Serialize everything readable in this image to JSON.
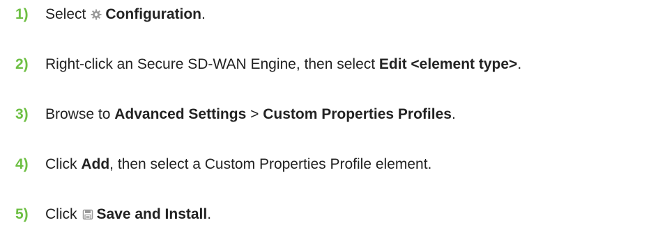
{
  "steps": [
    {
      "number": "1)",
      "parts": {
        "t1": "Select",
        "icon": "gear-icon",
        "b1": "Configuration",
        "t2": "."
      }
    },
    {
      "number": "2)",
      "parts": {
        "t1": "Right-click an Secure SD-WAN Engine, then select ",
        "b1": "Edit <element type>",
        "t2": "."
      }
    },
    {
      "number": "3)",
      "parts": {
        "t1": "Browse to ",
        "b1": "Advanced Settings",
        "t2": " > ",
        "b2": "Custom Properties Profiles",
        "t3": "."
      }
    },
    {
      "number": "4)",
      "parts": {
        "t1": "Click ",
        "b1": "Add",
        "t2": ", then select a Custom Properties Profile element."
      }
    },
    {
      "number": "5)",
      "parts": {
        "t1": "Click",
        "icon": "save-install-icon",
        "b1": "Save and Install",
        "t2": "."
      }
    }
  ],
  "colors": {
    "step_number": "#6dbf43",
    "text": "#222222",
    "icon": "#9a9a9a"
  }
}
